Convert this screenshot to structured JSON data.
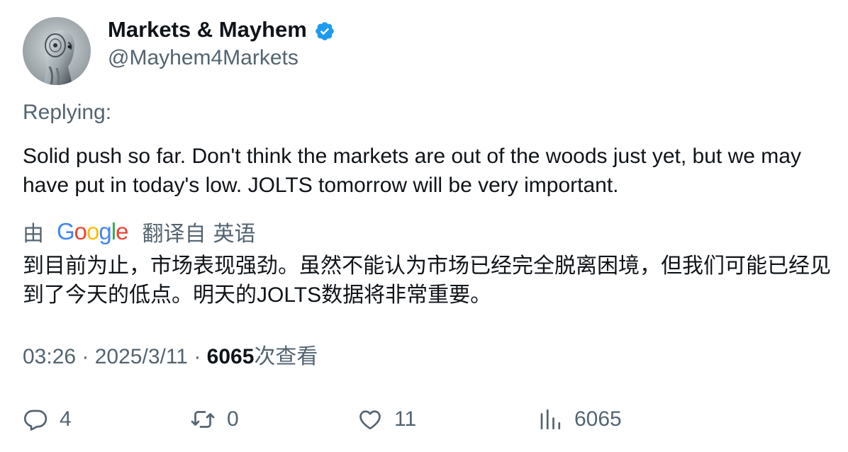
{
  "author": {
    "display_name": "Markets & Mayhem",
    "handle": "@Mayhem4Markets",
    "verified": true
  },
  "replying_label": "Replying:",
  "tweet_text": "Solid push so far. Don't think the markets are out of the woods just yet, but we may have put in today's low. JOLTS tomorrow will be very important.",
  "translation": {
    "prefix": "由",
    "provider": "Google",
    "suffix": "翻译自",
    "language": "英语",
    "text": "到目前为止，市场表现强劲。虽然不能认为市场已经完全脱离困境，但我们可能已经见到了今天的低点。明天的JOLTS数据将非常重要。"
  },
  "meta": {
    "time": "03:26",
    "separator": "·",
    "date": "2025/3/11",
    "views_count": "6065",
    "views_label": "次查看"
  },
  "actions": {
    "reply_count": "4",
    "retweet_count": "0",
    "like_count": "11",
    "views_count": "6065"
  },
  "colors": {
    "primary_text": "#0f1419",
    "secondary_text": "#536471",
    "verified_blue": "#1d9bf0"
  },
  "icons": {
    "verified": "verified-badge-icon",
    "reply": "reply-icon",
    "retweet": "retweet-icon",
    "like": "heart-icon",
    "views": "analytics-icon"
  }
}
